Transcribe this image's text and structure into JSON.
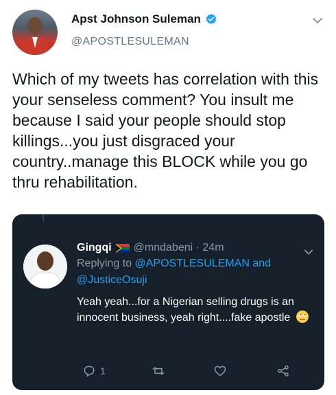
{
  "tweet": {
    "author_name": "Apst Johnson Suleman",
    "author_handle": "@APOSTLESULEMAN",
    "text": "Which of my tweets has correlation with this your senseless comment? You insult me because I said your people should stop killings...you just disgraced your country..manage this BLOCK while you go thru rehabilitation."
  },
  "quoted": {
    "name": "Gingqi",
    "handle_time": "@mndabeni · 24m",
    "replying_prefix": "Replying to",
    "mention1": "@APOSTLESULEMAN",
    "and_word": "and",
    "mention2": "@JusticeOsuji",
    "text": "Yeah yeah...for a Nigerian selling drugs is an innocent business,  yeah right....fake apostle",
    "reply_count": "1"
  },
  "icons": {
    "verified": "verified-badge-icon",
    "more": "chevron-down-icon",
    "reply": "reply-icon",
    "retweet": "retweet-icon",
    "like": "heart-icon",
    "share": "share-icon",
    "flag": "south-africa-flag-icon",
    "emoji": "rolling-eyes-emoji"
  },
  "colors": {
    "accent": "#1da1f2",
    "card_bg": "#15202b",
    "muted": "#8899a6"
  }
}
